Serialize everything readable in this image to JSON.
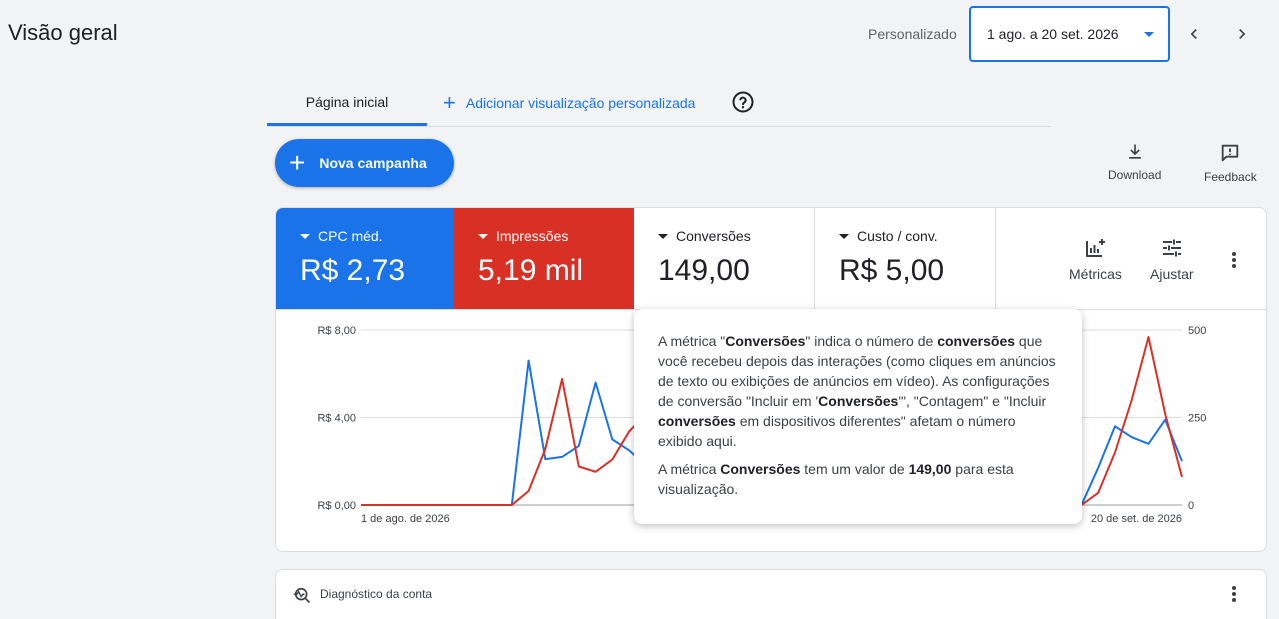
{
  "header": {
    "title": "Visão geral",
    "period_label": "Personalizado",
    "date_range": "1 ago. a 20 set. 2026"
  },
  "tabs": {
    "home": "Página inicial",
    "add_custom": "Adicionar visualização personalizada"
  },
  "actions": {
    "new_campaign": "Nova campanha",
    "download": "Download",
    "feedback": "Feedback"
  },
  "metrics": [
    {
      "name": "CPC méd.",
      "value": "R$ 2,73",
      "color": "#1a73e8"
    },
    {
      "name": "Impressões",
      "value": "5,19 mil",
      "color": "#d93025"
    },
    {
      "name": "Conversões",
      "value": "149,00"
    },
    {
      "name": "Custo / conv.",
      "value": "R$ 5,00"
    }
  ],
  "card_tools": {
    "metrics": "Métricas",
    "adjust": "Ajustar"
  },
  "tooltip": {
    "p1_a": "A métrica \"",
    "p1_b": "Conversões",
    "p1_c": "\" indica o número de ",
    "p1_d": "conversões",
    "p1_e": " que você recebeu depois das interações (como cliques em anúncios de texto ou exibições de anúncios em vídeo). As configurações de conversão \"Incluir em '",
    "p1_f": "Conversões",
    "p1_g": "'\", \"Contagem\" e \"Incluir ",
    "p1_h": "conversões",
    "p1_i": " em dispositivos diferentes\" afetam o número exibido aqui.",
    "p2_a": "A métrica ",
    "p2_b": "Conversões",
    "p2_c": " tem um valor de ",
    "p2_d": "149,00",
    "p2_e": " para esta visualização."
  },
  "diagnostics": {
    "title": "Diagnóstico da conta"
  },
  "chart_data": {
    "type": "line",
    "x_start_label": "1 de ago. de 2026",
    "x_end_label": "20 de set. de 2026",
    "y_left": {
      "ticks": [
        "R$ 8,00",
        "R$ 4,00",
        "R$ 0,00"
      ],
      "range": [
        0,
        8
      ]
    },
    "y_right": {
      "ticks": [
        "500",
        "250",
        "0"
      ],
      "range": [
        0,
        500
      ]
    },
    "series": [
      {
        "name": "CPC méd.",
        "axis": "left",
        "color": "#1a73e8",
        "values": [
          0,
          0,
          0,
          0,
          0,
          0,
          0,
          0,
          0,
          0,
          6.6,
          2.1,
          2.2,
          2.7,
          5.6,
          3.0,
          2.5,
          1.8,
          1.2,
          null,
          null,
          null,
          null,
          null,
          null,
          null,
          null,
          null,
          null,
          null,
          null,
          null,
          null,
          null,
          null,
          null,
          null,
          null,
          null,
          null,
          null,
          null,
          null,
          0,
          1.7,
          3.6,
          3.1,
          2.8,
          3.9,
          2.0
        ]
      },
      {
        "name": "Impressões",
        "axis": "right",
        "color": "#d93025",
        "values": [
          0,
          0,
          0,
          0,
          0,
          0,
          0,
          0,
          0,
          0,
          40,
          160,
          360,
          110,
          95,
          130,
          210,
          260,
          null,
          null,
          null,
          null,
          null,
          null,
          null,
          null,
          null,
          null,
          null,
          null,
          null,
          null,
          null,
          null,
          null,
          null,
          null,
          null,
          null,
          null,
          null,
          null,
          null,
          0,
          35,
          150,
          300,
          480,
          260,
          80
        ]
      }
    ]
  }
}
